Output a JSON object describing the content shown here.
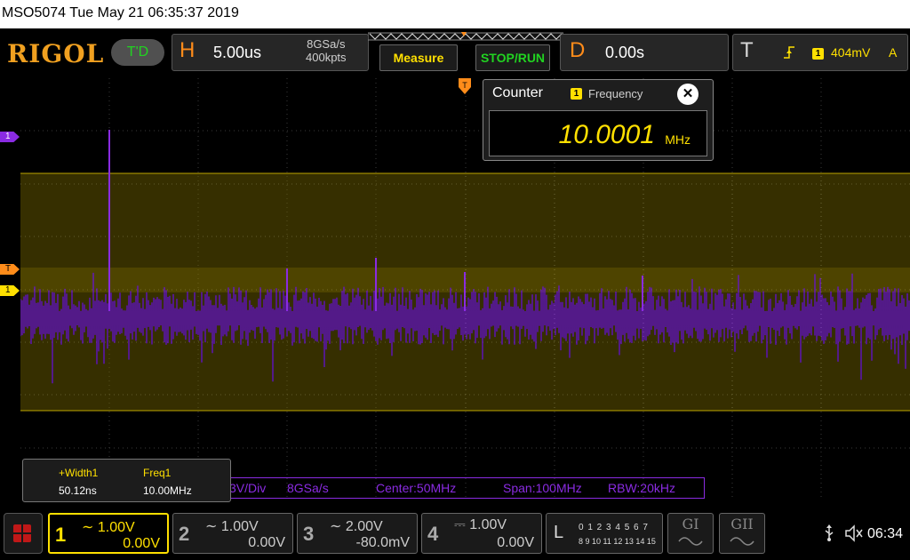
{
  "window": {
    "title": "MSO5074  Tue May 21 06:35:37 2019"
  },
  "header": {
    "logo": "RIGOL",
    "trigger_status": "T'D",
    "horizontal": {
      "letter": "H",
      "timebase": "5.00us",
      "sample_rate": "8GSa/s",
      "memory_depth": "400kpts"
    },
    "measure_label": "Measure",
    "stoprun_label": "STOP/RUN",
    "delay": {
      "letter": "D",
      "value": "0.00s"
    },
    "trigger": {
      "letter": "T",
      "source": "1",
      "level": "404mV",
      "mode": "A"
    }
  },
  "counter": {
    "title": "Counter",
    "source": "1",
    "label": "Frequency",
    "value": "10.0001",
    "unit": "MHz",
    "close_glyph": "✕"
  },
  "markers": {
    "math": "1",
    "trigger": "T",
    "ch1": "1"
  },
  "measurements": {
    "items": [
      {
        "name": "+Width1",
        "value": "50.12ns"
      },
      {
        "name": "Freq1",
        "value": "10.00MHz"
      }
    ]
  },
  "fft": {
    "scale": "3V/Div",
    "rate": "8GSa/s",
    "center": "Center:50MHz",
    "span": "Span:100MHz",
    "rbw": "RBW:20kHz"
  },
  "channels": [
    {
      "num": "1",
      "scale": "1.00V",
      "offset": "0.00V",
      "color": "#ffe000",
      "active": true
    },
    {
      "num": "2",
      "scale": "1.00V",
      "offset": "0.00V",
      "color": "#aaaaaa",
      "active": false
    },
    {
      "num": "3",
      "scale": "2.00V",
      "offset": "-80.0mV",
      "color": "#aaaaaa",
      "active": false
    },
    {
      "num": "4",
      "scale": "1.00V",
      "offset": "0.00V",
      "color": "#aaaaaa",
      "active": false
    }
  ],
  "logic": {
    "letter": "L",
    "row1": "0 1 2 3  4 5 6 7",
    "row2": "8 9 10 11 12 13 14 15"
  },
  "gen_buttons": [
    {
      "label": "GI"
    },
    {
      "label": "GII"
    }
  ],
  "status": {
    "time": "06:34"
  },
  "colors": {
    "ch1": "#ffe000",
    "math": "#8a2be2",
    "trigger": "#ff8c1a",
    "run_ok": "#21d321"
  }
}
